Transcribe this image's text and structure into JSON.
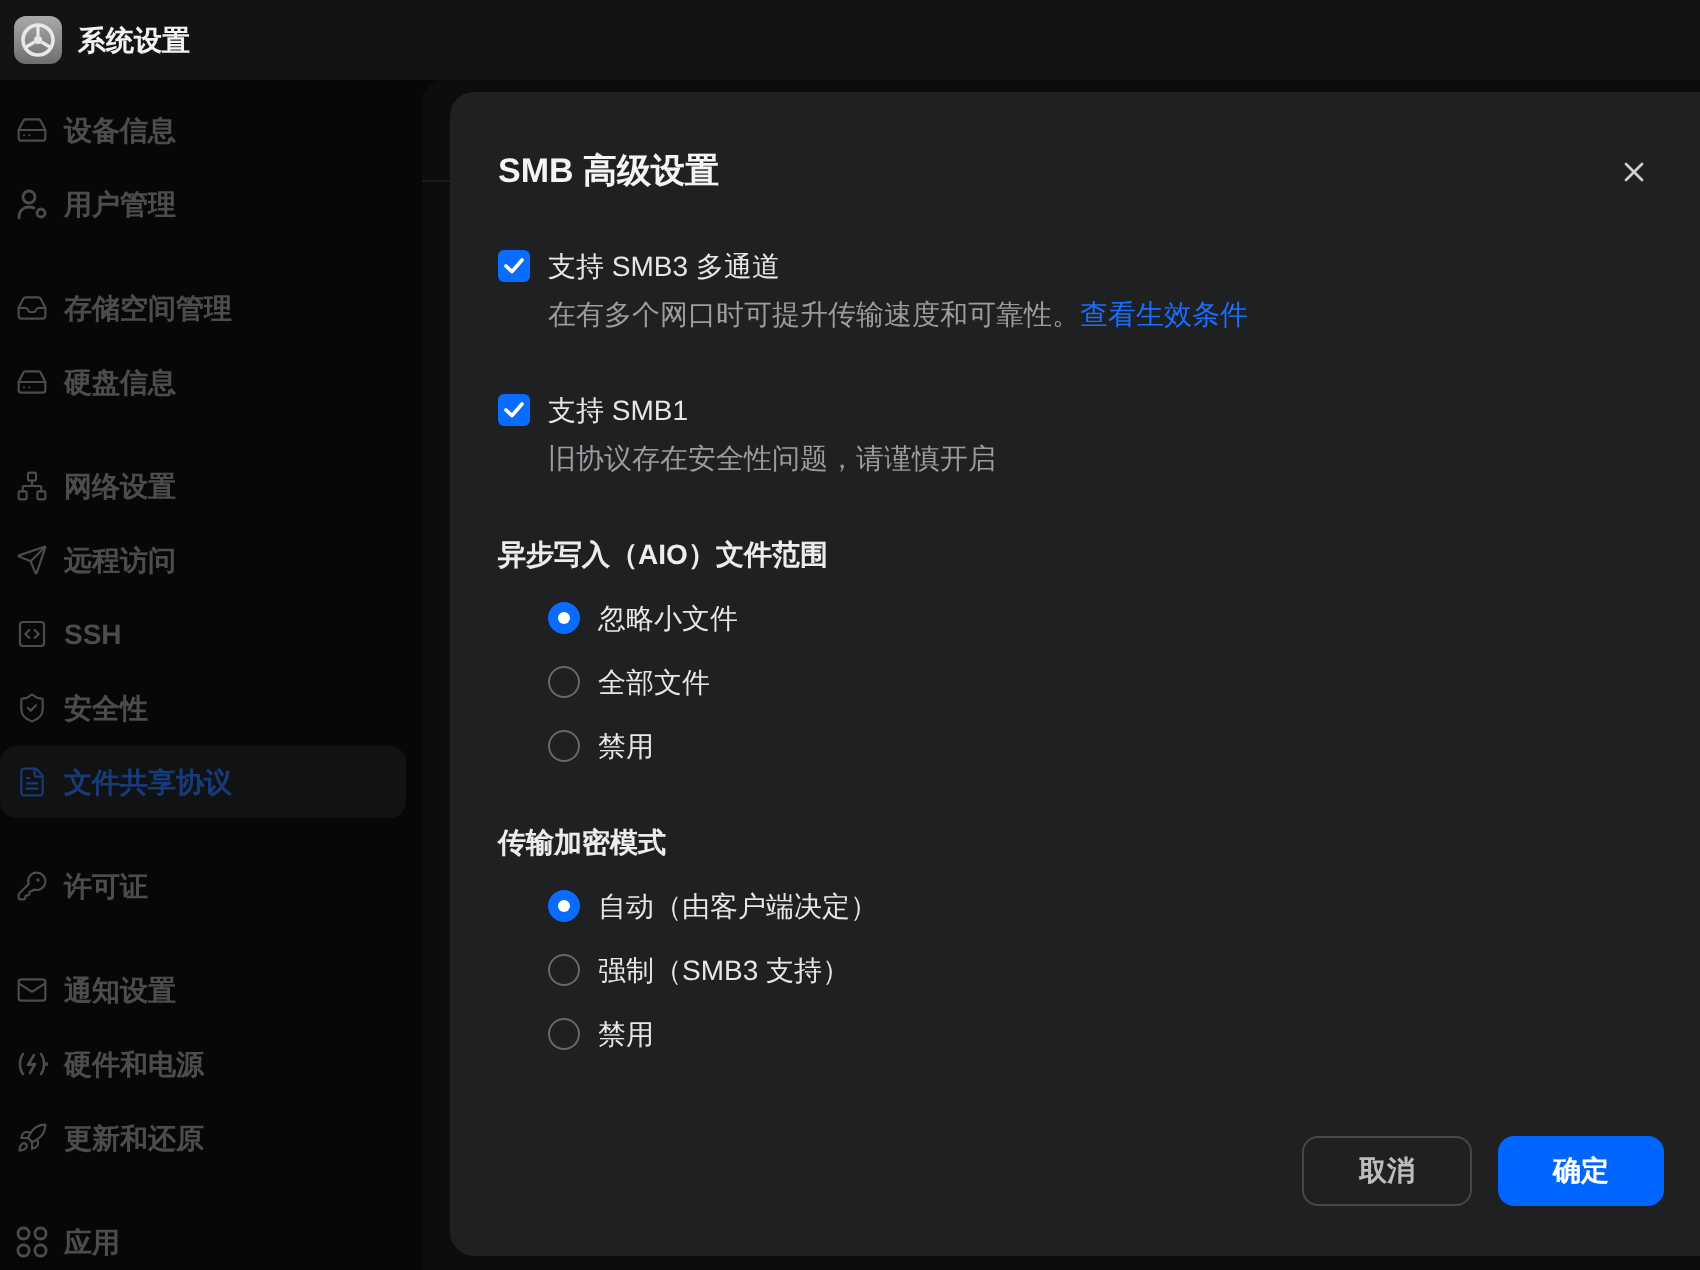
{
  "app": {
    "title": "系统设置"
  },
  "sidebar": {
    "groups": [
      {
        "items": [
          {
            "label": "设备信息",
            "selected": false
          },
          {
            "label": "用户管理",
            "selected": false
          }
        ]
      },
      {
        "items": [
          {
            "label": "存储空间管理",
            "selected": false
          },
          {
            "label": "硬盘信息",
            "selected": false
          }
        ]
      },
      {
        "items": [
          {
            "label": "网络设置",
            "selected": false
          },
          {
            "label": "远程访问",
            "selected": false
          },
          {
            "label": "SSH",
            "selected": false
          },
          {
            "label": "安全性",
            "selected": false
          },
          {
            "label": "文件共享协议",
            "selected": true
          }
        ]
      },
      {
        "items": [
          {
            "label": "许可证",
            "selected": false
          }
        ]
      },
      {
        "items": [
          {
            "label": "通知设置",
            "selected": false
          },
          {
            "label": "硬件和电源",
            "selected": false
          },
          {
            "label": "更新和还原",
            "selected": false
          }
        ]
      },
      {
        "items": [
          {
            "label": "应用",
            "selected": false
          }
        ]
      }
    ]
  },
  "dialog": {
    "title": "SMB 高级设置",
    "checkboxes": [
      {
        "label": "支持 SMB3 多通道",
        "checked": true,
        "description": "在有多个网口时可提升传输速度和可靠性。",
        "link": "查看生效条件"
      },
      {
        "label": "支持 SMB1",
        "checked": true,
        "description": "旧协议存在安全性问题，请谨慎开启"
      }
    ],
    "sections": [
      {
        "heading": "异步写入（AIO）文件范围",
        "options": [
          {
            "label": "忽略小文件",
            "selected": true
          },
          {
            "label": "全部文件",
            "selected": false
          },
          {
            "label": "禁用",
            "selected": false
          }
        ]
      },
      {
        "heading": "传输加密模式",
        "options": [
          {
            "label": "自动（由客户端决定）",
            "selected": true
          },
          {
            "label": "强制（SMB3 支持）",
            "selected": false
          },
          {
            "label": "禁用",
            "selected": false
          }
        ]
      }
    ],
    "buttons": [
      {
        "label": "取消",
        "kind": "secondary"
      },
      {
        "label": "确定",
        "kind": "primary"
      }
    ]
  }
}
